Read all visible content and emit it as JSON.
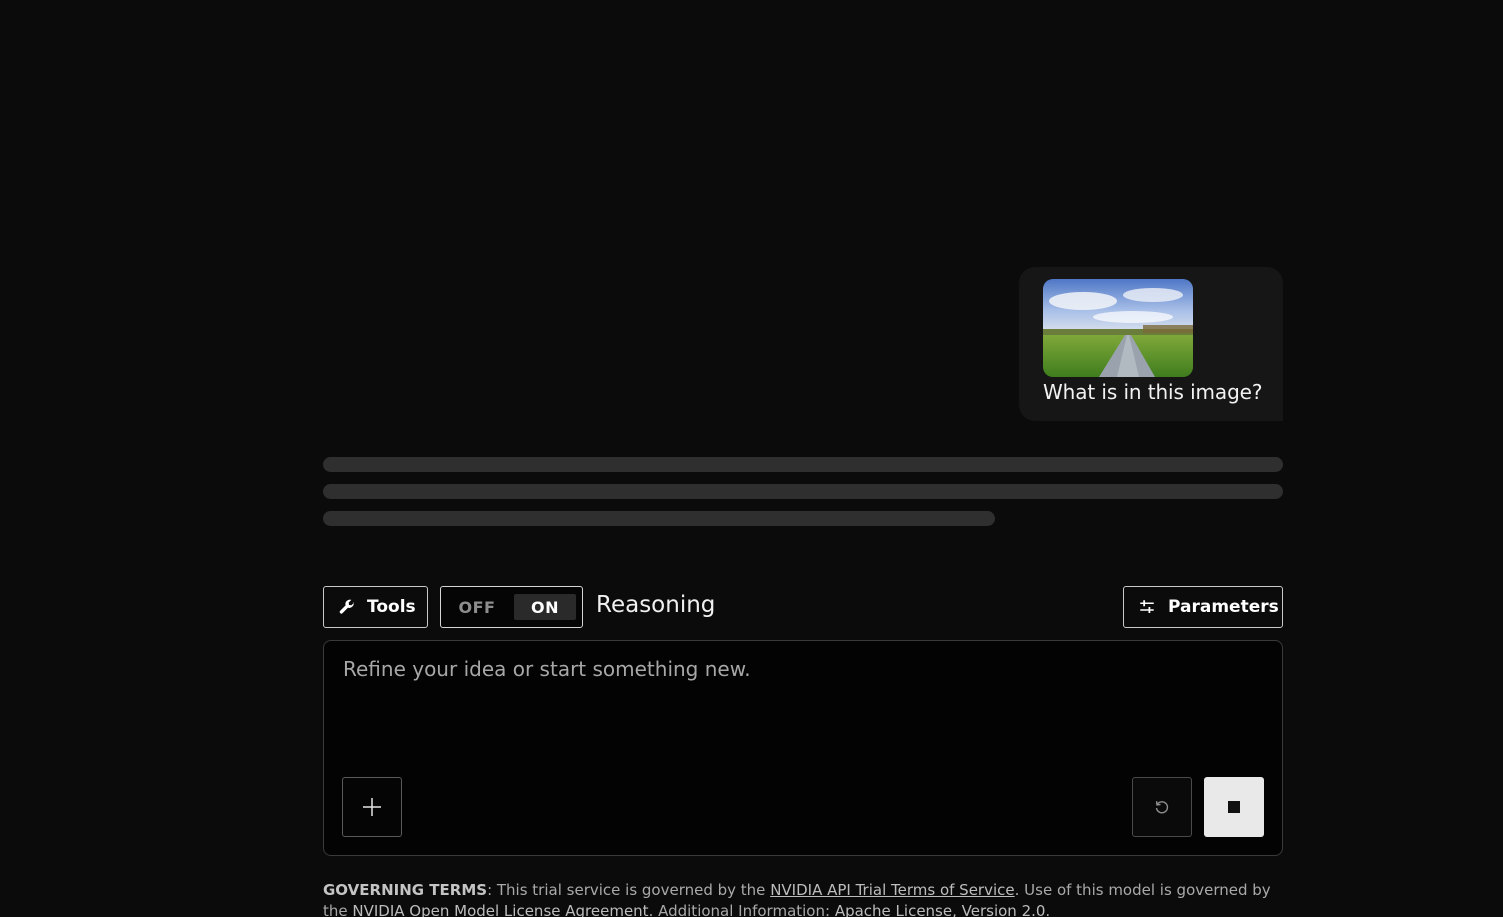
{
  "conversation": {
    "user_message": {
      "image_alt": "boardwalk-through-grass-field",
      "text": "What is in this image?"
    }
  },
  "toolbar": {
    "tools_label": "Tools",
    "reasoning_toggle": {
      "off_label": "OFF",
      "on_label": "ON",
      "selected": "ON"
    },
    "reasoning_label": "Reasoning",
    "parameters_label": "Parameters"
  },
  "composer": {
    "placeholder": "Refine your idea or start something new.",
    "value": ""
  },
  "footer": {
    "terms_heading": "GOVERNING TERMS",
    "text_1": ": This trial service is governed by the ",
    "link_terms": "NVIDIA API Trial Terms of Service",
    "text_2": ". Use of this model is governed by the ",
    "link_license": "NVIDIA Open Model License Agreement",
    "text_3": ". Additional Information: ",
    "link_apache": "Apache License, Version 2.0",
    "text_4": "."
  },
  "icons": {
    "tools": "wrench-icon",
    "parameters": "sliders-icon",
    "add": "plus-icon",
    "regenerate": "refresh-icon",
    "stop": "stop-icon"
  }
}
